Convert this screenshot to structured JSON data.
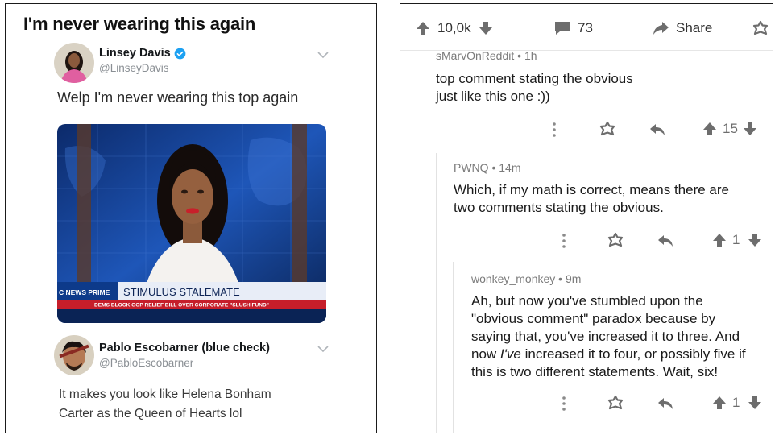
{
  "left": {
    "title": "I'm never wearing this again",
    "tweet1": {
      "name": "Linsey Davis",
      "handle": "@LinseyDavis",
      "text": "Welp I'm never wearing this top again",
      "image": {
        "chyron_brand": "C NEWS PRIME",
        "chyron_headline": "STIMULUS STALEMATE",
        "chyron_subline": "DEMS BLOCK GOP RELIEF BILL OVER CORPORATE \"SLUSH FUND\""
      }
    },
    "tweet2": {
      "name": "Pablo Escobarner (blue check)",
      "handle": "@PabloEscobarner",
      "text_line1": "It makes you look like Helena Bonham",
      "text_line2": "Carter as the Queen of Hearts lol"
    }
  },
  "right": {
    "topbar": {
      "score": "10,0k",
      "comments": "73",
      "share": "Share"
    },
    "comments": [
      {
        "author": "sMarvOnReddit",
        "age": "1h",
        "line1": "top comment stating the obvious",
        "line2": "just like this one :))",
        "score": "15"
      },
      {
        "author": "PWNQ",
        "age": "14m",
        "line1": "Which, if my math is correct, means there are",
        "line2": "two comments stating the obvious.",
        "score": "1"
      },
      {
        "author": "wonkey_monkey",
        "age": "9m",
        "line1": "Ah, but now you've stumbled upon the",
        "line2": "\"obvious comment\" paradox because by",
        "line3": "saying that, you've increased it to three. And",
        "line4_pre": "now ",
        "line4_em": "I've",
        "line4_post": " increased it to four, or possibly five if",
        "line5": "this is two different statements. Wait, six!",
        "score": "1"
      }
    ],
    "separator": " • ",
    "colors": {
      "icon_gray": "#6d6d6d",
      "text": "#1a1a1a",
      "meta": "#7a7a7a"
    }
  }
}
